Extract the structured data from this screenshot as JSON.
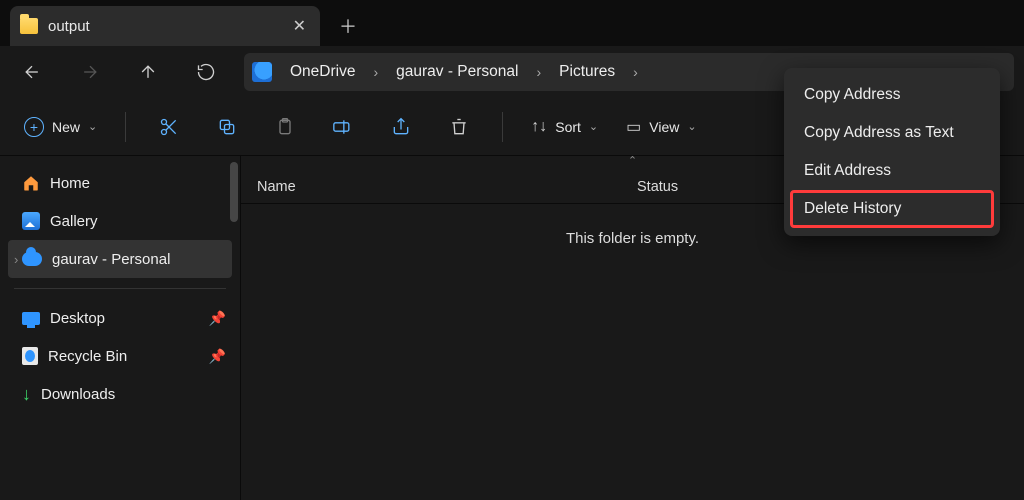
{
  "tab": {
    "title": "output"
  },
  "breadcrumb": {
    "segments": [
      "OneDrive",
      "gaurav - Personal",
      "Pictures"
    ]
  },
  "toolbar": {
    "new_label": "New",
    "sort_label": "Sort",
    "view_label": "View"
  },
  "sidebar": {
    "home": "Home",
    "gallery": "Gallery",
    "personal": "gaurav - Personal",
    "desktop": "Desktop",
    "recycle": "Recycle Bin",
    "downloads": "Downloads"
  },
  "columns": {
    "name": "Name",
    "status": "Status"
  },
  "content": {
    "empty_message": "This folder is empty."
  },
  "context_menu": {
    "items": [
      "Copy Address",
      "Copy Address as Text",
      "Edit Address",
      "Delete History"
    ],
    "highlight_index": 3
  }
}
